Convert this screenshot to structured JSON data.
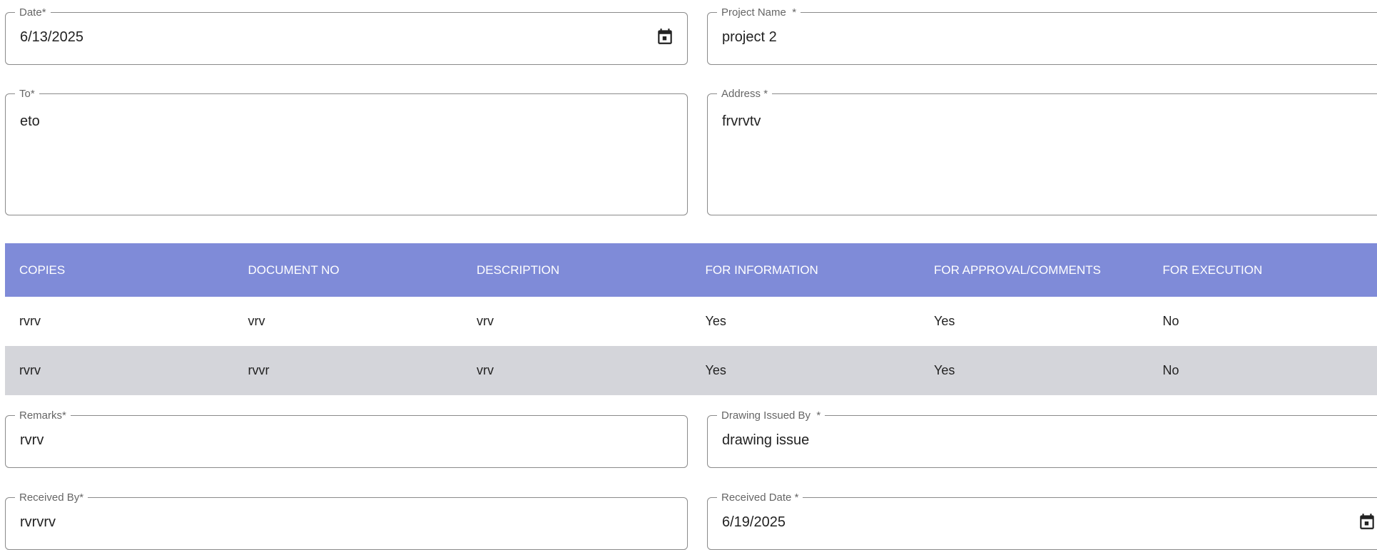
{
  "form": {
    "date": {
      "label": "Date",
      "required_mark": "*",
      "value": "6/13/2025"
    },
    "project_name": {
      "label": "Project Name",
      "required_mark": "*",
      "value": "project 2"
    },
    "to": {
      "label": "To",
      "required_mark": "*",
      "value": "eto"
    },
    "address": {
      "label": "Address",
      "required_mark": "*",
      "value": "frvrvtv"
    },
    "remarks": {
      "label": "Remarks",
      "required_mark": "*",
      "value": "rvrv"
    },
    "drawing_issued_by": {
      "label": "Drawing Issued By",
      "required_mark": "*",
      "value": "drawing issue"
    },
    "received_by": {
      "label": "Received By",
      "required_mark": "*",
      "value": "rvrvrv"
    },
    "received_date": {
      "label": "Received Date",
      "required_mark": "*",
      "value": "6/19/2025"
    }
  },
  "table": {
    "columns": [
      "COPIES",
      "DOCUMENT NO",
      "DESCRIPTION",
      "FOR INFORMATION",
      "FOR APPROVAL/COMMENTS",
      "FOR EXECUTION"
    ],
    "rows": [
      [
        "rvrv",
        "vrv",
        "vrv",
        "Yes",
        "Yes",
        "No"
      ],
      [
        "rvrv",
        "rvvr",
        "vrv",
        "Yes",
        "Yes",
        "No"
      ]
    ]
  },
  "icons": {
    "date_picker": "calendar-icon"
  },
  "colors": {
    "table_header_bg": "#7f8bd8",
    "table_header_text": "#ffffff",
    "alt_row_bg": "#d4d5da",
    "field_border": "#8a8a8a"
  }
}
